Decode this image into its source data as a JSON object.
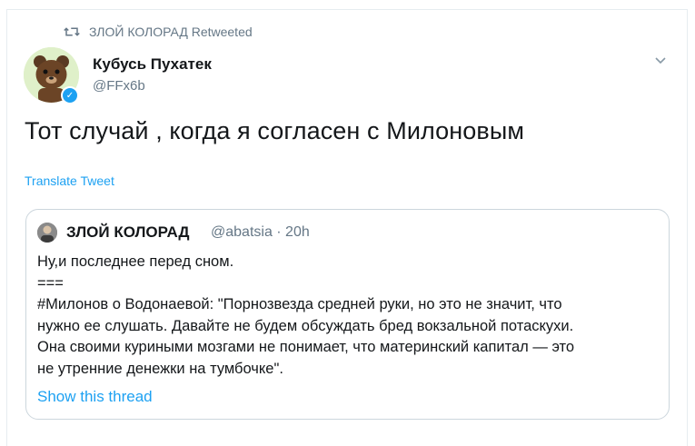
{
  "retweet": {
    "icon": "retweet-icon",
    "text": "ЗЛОЙ КОЛОРАД Retweeted"
  },
  "author": {
    "name": "Кубусь Пухатек",
    "handle": "@FFx6b",
    "avatar_icon": "bear-avatar"
  },
  "menu": {
    "icon": "chevron-down-icon"
  },
  "tweet": {
    "text": "Тот случай , когда я согласен с Милоновым"
  },
  "translate_label": "Translate Tweet",
  "quote": {
    "name": "ЗЛОЙ КОЛОРАД",
    "meta": "@abatsia · 20h",
    "lines": [
      "Ну,и последнее перед сном.",
      "===",
      "#Милонов о Водонаевой: \"Порнозвезда средней руки, но это не значит, что",
      "нужно ее слушать. Давайте не будем обсуждать бред вокзальной потаскухи.",
      "Она своими куриными мозгами не понимает, что материнский капитал — это",
      "не утренние денежки на тумбочке\"."
    ],
    "show_thread": "Show this thread"
  },
  "colors": {
    "accent": "#1da1f2",
    "muted": "#657786",
    "border": "#ccd6dd"
  }
}
